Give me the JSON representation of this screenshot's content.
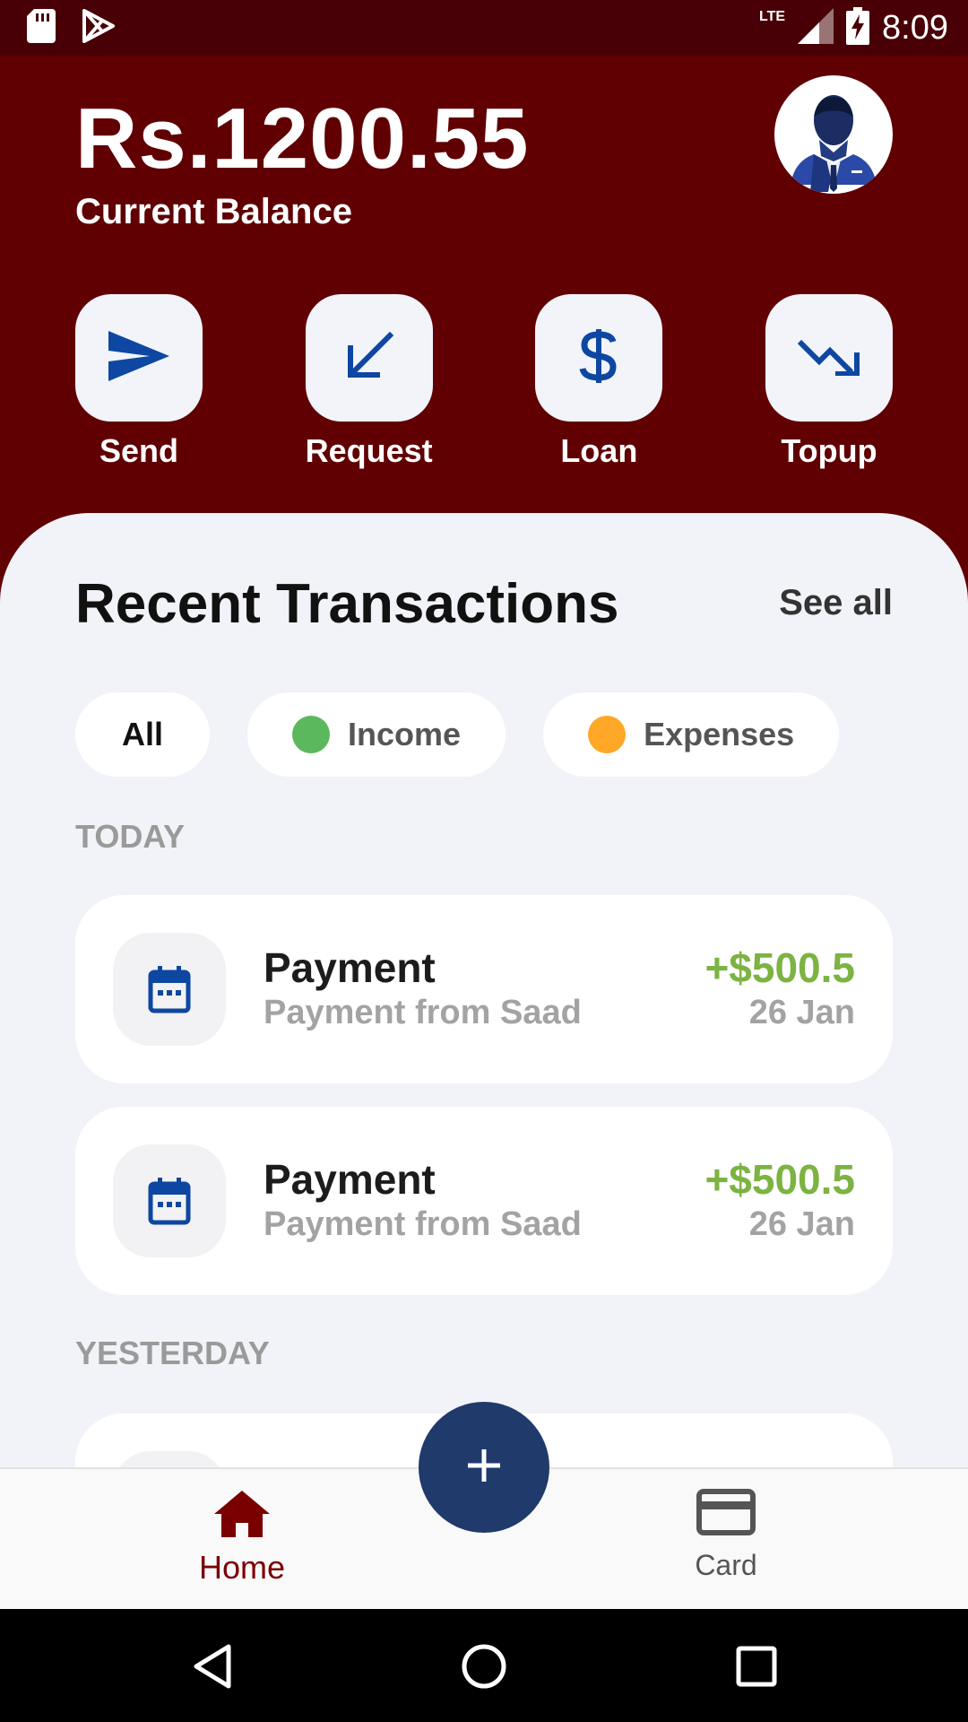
{
  "status_bar": {
    "time": "8:09",
    "network": "LTE",
    "icons": [
      "sd-card-icon",
      "play-store-icon",
      "signal-icon",
      "battery-charging-icon"
    ]
  },
  "header": {
    "balance": "Rs.1200.55",
    "balance_label": "Current Balance",
    "avatar_icon": "user-avatar"
  },
  "actions": [
    {
      "label": "Send",
      "icon": "send-icon"
    },
    {
      "label": "Request",
      "icon": "arrow-down-left-icon"
    },
    {
      "label": "Loan",
      "icon": "dollar-icon"
    },
    {
      "label": "Topup",
      "icon": "trending-down-icon"
    }
  ],
  "transactions": {
    "title": "Recent Transactions",
    "see_all": "See all",
    "filters": [
      {
        "label": "All"
      },
      {
        "label": "Income",
        "color": "#5cb85c"
      },
      {
        "label": "Expenses",
        "color": "#ffa726"
      }
    ],
    "groups": [
      {
        "label": "TODAY",
        "items": [
          {
            "title": "Payment",
            "subtitle": "Payment from Saad",
            "amount": "+$500.5",
            "date": "26 Jan",
            "icon": "calendar-icon"
          },
          {
            "title": "Payment",
            "subtitle": "Payment from Saad",
            "amount": "+$500.5",
            "date": "26 Jan",
            "icon": "calendar-icon"
          }
        ]
      },
      {
        "label": "YESTERDAY",
        "items": []
      }
    ]
  },
  "bottom_nav": {
    "items": [
      {
        "label": "Home",
        "icon": "home-icon",
        "active": true
      },
      {
        "label": "Card",
        "icon": "credit-card-icon",
        "active": false
      }
    ],
    "fab_icon": "plus-icon"
  },
  "colors": {
    "header_bg": "#600003",
    "status_bg": "#480006",
    "primary_blue": "#0d47a1",
    "income_green": "#7cb342",
    "fab": "#1f3a6b"
  }
}
